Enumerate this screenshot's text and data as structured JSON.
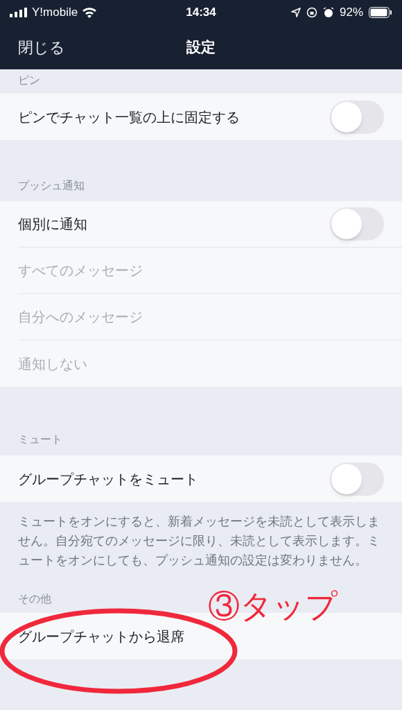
{
  "status_bar": {
    "carrier": "Y!mobile",
    "time": "14:34",
    "battery": "92%"
  },
  "nav": {
    "close": "閉じる",
    "title": "設定"
  },
  "sections": [
    {
      "header": "ピン",
      "rows": [
        {
          "kind": "toggle",
          "label": "ピンでチャット一覧の上に固定する",
          "on": false
        }
      ]
    },
    {
      "header": "プッシュ通知",
      "rows": [
        {
          "kind": "toggle",
          "label": "個別に通知",
          "on": false
        },
        {
          "kind": "option",
          "label": "すべてのメッセージ",
          "disabled": true
        },
        {
          "kind": "option",
          "label": "自分へのメッセージ",
          "disabled": true
        },
        {
          "kind": "option",
          "label": "通知しない",
          "disabled": true
        }
      ]
    },
    {
      "header": "ミュート",
      "rows": [
        {
          "kind": "toggle",
          "label": "グループチャットをミュート",
          "on": false
        }
      ],
      "note": "ミュートをオンにすると、新着メッセージを未読として表示しません。自分宛てのメッセージに限り、未読として表示します。ミュートをオンにしても、プッシュ通知の設定は変わりません。"
    },
    {
      "header": "その他",
      "rows": [
        {
          "kind": "option",
          "label": "グループチャットから退席",
          "disabled": false
        }
      ]
    }
  ],
  "annotation": {
    "text": "③タップ"
  }
}
